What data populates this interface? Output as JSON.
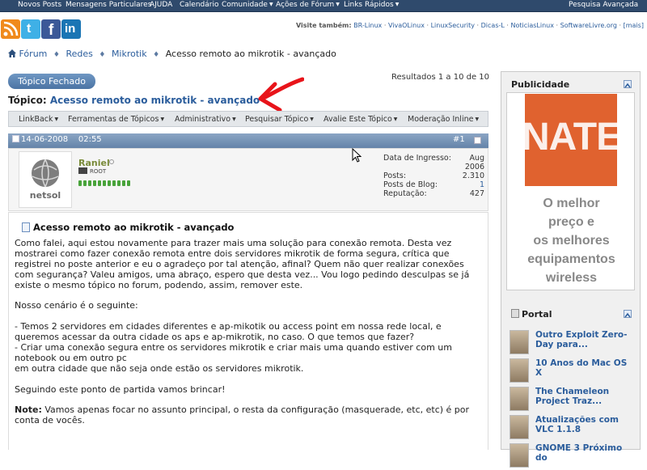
{
  "topnav": {
    "items": [
      "Novos Posts",
      "Mensagens Particulares",
      "AJUDA",
      "Calendário",
      "Comunidade",
      "Ações de Fórum",
      "Links Rápidos"
    ],
    "right": "Pesquisa Avançada"
  },
  "social": {
    "rss": "rss-icon",
    "twitter": "twitter-icon",
    "facebook": "facebook-icon",
    "linkedin": "linkedin-icon"
  },
  "also_seen": {
    "label": "Visite também:",
    "links": [
      "BR-Linux",
      "VivaOLinux",
      "LinuxSecurity",
      "Dicas-L",
      "NoticiasLinux",
      "SoftwareLivre.org",
      "[mais]"
    ]
  },
  "breadcrumb": {
    "items": [
      "Fórum",
      "Redes",
      "Mikrotik"
    ],
    "current": "Acesso remoto ao mikrotik - avançado"
  },
  "closed_button": "Tópico Fechado",
  "results": "Resultados 1 a 10 de 10",
  "topic": {
    "label": "Tópico:",
    "title": "Acesso remoto ao mikrotik - avançado"
  },
  "toolbar": [
    "LinkBack",
    "Ferramentas de Tópicos",
    "Administrativo",
    "Pesquisar Tópico",
    "Avalie Este Tópico",
    "Moderação Inline"
  ],
  "post": {
    "date": "14-06-2008",
    "time": "02:55",
    "number": "#1",
    "username": "Raniel",
    "rank": "ROOT",
    "stats": [
      {
        "k": "Data de Ingresso:",
        "v": "Aug"
      },
      {
        "k": "",
        "v": "2006"
      },
      {
        "k": "Posts:",
        "v": "2.310"
      },
      {
        "k": "Posts de Blog:",
        "v": "1"
      },
      {
        "k": "Reputação:",
        "v": "427"
      }
    ],
    "title": "Acesso remoto ao mikrotik - avançado",
    "paragraphs": [
      "Como falei, aqui estou novamente para trazer mais uma solução para conexão remota. Desta vez",
      "mostrarei como fazer conexão remota entre dois servidores mikrotik de forma segura, crítica que",
      "registrei no poste anterior e eu o agradeço por tal atenção, afinal? Quem não quer realizar conexões",
      "com segurança? Valeu amigos, uma abraço, espero que desta vez... Vou logo pedindo desculpas se já",
      "existe o mesmo tópico no forum, podendo, assim, remover este.",
      "",
      "Nosso cenário é o seguinte:",
      "",
      "- Temos 2 servidores em cidades diferentes e ap-mikotik ou access point em nossa rede local, e",
      "queremos acessar da outra cidade os aps e ap-mikrotik, no caso. O que temos que fazer?",
      "- Criar uma conexão segura entre os servidores mikrotik e criar mais uma quando estiver com um",
      "notebook ou em outro pc",
      "em outra cidade que não seja onde estão os servidores mikrotik.",
      "",
      "Seguindo este ponto de partida vamos brincar!",
      ""
    ],
    "note_label": "Note:",
    "note_line1": " Vamos apenas focar no assunto principal, o resta da configuração (masquerade, etc, etc) é por",
    "note_line2": "conta de vocês."
  },
  "sidebar": {
    "ads_title": "Publicidade",
    "ad_image_text": "NATE",
    "ad_text": [
      "O melhor",
      "preço e",
      "os melhores",
      "equipamentos",
      "wireless"
    ],
    "portal_title": "Portal",
    "portal_items": [
      "Outro Exploit Zero-Day para...",
      "10 Anos do Mac OS X",
      "The Chameleon Project Traz...",
      "Atualizações com VLC 1.1.8",
      "GNOME 3 Próximo do"
    ]
  }
}
